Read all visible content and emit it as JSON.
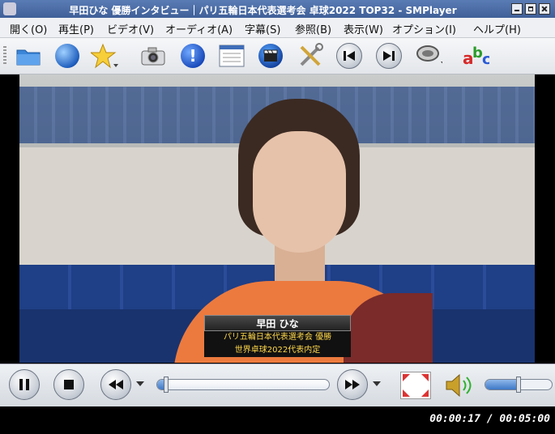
{
  "window": {
    "title": "早田ひな 優勝インタビュー｜パリ五輪日本代表選考会 卓球2022 TOP32 - SMPlayer"
  },
  "menu": {
    "items": [
      "開く(O)",
      "再生(P)",
      "ビデオ(V)",
      "オーディオ(A)",
      "字幕(S)",
      "参照(B)",
      "表示(W)",
      "オプション(I)",
      "ヘルプ(H)"
    ]
  },
  "toolbar": {
    "icons": [
      "folder-icon",
      "globe-icon",
      "favorites-star-icon",
      "screenshot-camera-icon",
      "info-icon",
      "playlist-icon",
      "video-clapper-icon",
      "preferences-tools-icon",
      "previous-track-icon",
      "next-track-icon",
      "audio-track-icon",
      "subtitle-abc-icon"
    ]
  },
  "video": {
    "caption_name": "早田 ひな",
    "caption_line1": "パリ五輪日本代表選考会 優勝",
    "caption_line2": "世界卓球2022代表内定"
  },
  "controls": {
    "seek_progress": 0.057,
    "volume_level": 0.5
  },
  "status": {
    "time": "00:00:17 / 00:05:00"
  },
  "colors": {
    "title_bar": "#4a6ca8",
    "caption_text": "#ffd84a",
    "accent": "#3d78c7"
  }
}
